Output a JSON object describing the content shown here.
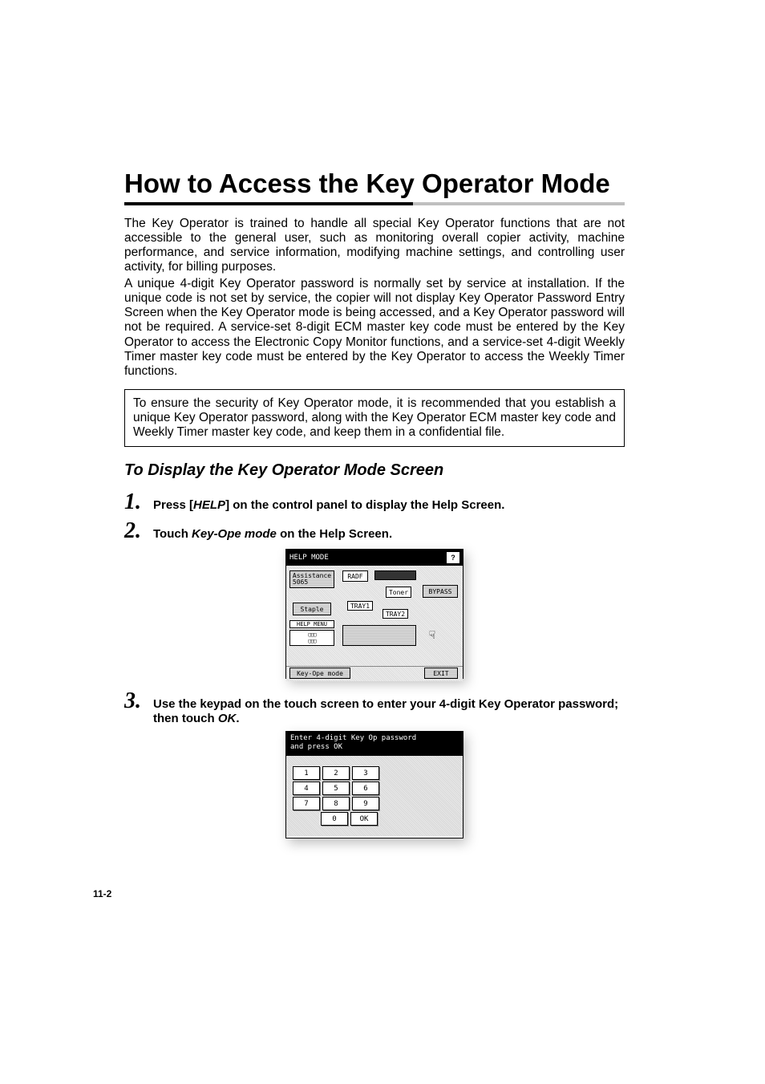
{
  "title": "How to Access the Key Operator Mode",
  "para1": "The Key Operator is trained to handle all special Key Operator functions that are not accessible to the general user, such as monitoring overall copier activity, machine performance, and service information, modifying machine settings, and controlling user activity, for billing purposes.",
  "para2": "A unique 4-digit Key Operator password is normally set by service at installation. If the unique code is not set by service, the copier will not display Key Operator Password Entry Screen when the Key Operator mode is being accessed, and a Key Operator password will not be required. A service-set 8-digit ECM master key code must be entered by the Key Operator to access the Electronic Copy Monitor functions, and a service-set 4-digit Weekly Timer master key code must be entered by the Key Operator to access the Weekly Timer functions.",
  "box": "To ensure the security of Key Operator mode, it is recommended that you establish a unique Key Operator password, along with the Key Operator ECM master key code and Weekly Timer master key code, and keep them in a confidential file.",
  "sub_title": "To Display the Key Operator Mode Screen",
  "steps": {
    "s1": {
      "num": "1.",
      "pre": "Press [",
      "bold": "HELP",
      "post": "] on the control panel to display the Help Screen."
    },
    "s2": {
      "num": "2.",
      "pre": "Touch ",
      "bold": "Key-Ope mode",
      "post": " on the Help Screen."
    },
    "s3": {
      "num": "3.",
      "pre": "Use the keypad on the touch screen to enter your 4-digit Key Operator password; then touch ",
      "bold": "OK",
      "post": "."
    }
  },
  "screen1": {
    "title": "HELP MODE",
    "help_icon": "?",
    "buttons": {
      "assistance": "Assistance\n5065",
      "radf": "RADF",
      "toner": "Toner",
      "bypass": "BYPASS",
      "staple": "Staple",
      "tray1": "TRAY1",
      "tray2": "TRAY2",
      "help_menu": "HELP MENU",
      "key_ope": "Key-Ope mode",
      "exit": "EXIT"
    }
  },
  "screen2": {
    "header": "Enter 4-digit Key Op password\nand press OK",
    "keys": {
      "k1": "1",
      "k2": "2",
      "k3": "3",
      "k4": "4",
      "k5": "5",
      "k6": "6",
      "k7": "7",
      "k8": "8",
      "k9": "9",
      "k0": "0",
      "ok": "OK"
    }
  },
  "page_num": "11-2"
}
